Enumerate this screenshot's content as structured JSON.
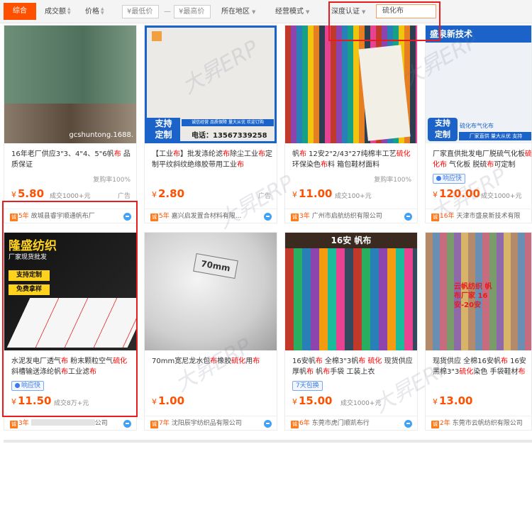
{
  "filter_bar": {
    "sort_default": "综合",
    "sort_volume": "成交额",
    "sort_price": "价格",
    "min_price_placeholder": "¥最低价",
    "max_price_placeholder": "¥最高价",
    "price_separator": "—",
    "region": "所在地区",
    "business_mode": "经营模式",
    "depth_cert": "深度认证",
    "search_value": "硫化布"
  },
  "watermark": "大昇ERP",
  "products": [
    {
      "title_parts": [
        "16年老厂供应3\"3、4\"4、5\"6帆布 品质保证"
      ],
      "repurchase": "复购率100%",
      "price": "5.80",
      "sold": "成交1000+元",
      "ad": "广告",
      "years": "5年",
      "company": "故城县睿宇顺通帆布厂",
      "image_caption": "gcshuntong.1688."
    },
    {
      "title_parts": [
        "【工业布】批发涤纶滤布除尘工业布定制平纹斜纹绝缘胶带用工业布"
      ],
      "price": "2.80",
      "ad": "广告",
      "years": "5年",
      "company": "嘉兴启发置合材料有限...",
      "image_badge_1": "支持",
      "image_badge_2": "定制",
      "image_phone": "电话：13567339258",
      "image_slogan": "诚信经营 品质保障 量大从优 欢迎订购"
    },
    {
      "title_parts": [
        "帆布 12安2\"2/43\"27纯棉丰工艺硫化环保染色布料 箱包鞋材面料"
      ],
      "repurchase": "复购率100%",
      "price": "11.00",
      "sold": "成交100+元",
      "years": "3年",
      "company": "广州市启航纺织有限公司"
    },
    {
      "title_parts": [
        "厂家直供批发电厂脱硫气化板硫化布 气化板 脱硫布可定制"
      ],
      "badge": "响应快",
      "price": "120.00",
      "sold": "成交1000+元",
      "years": "16年",
      "company": "天津市盛泉新技术有限",
      "image_header": "盛泉新技术",
      "image_badge_1": "支持",
      "image_badge_2": "定制",
      "image_slogan": "厂家直供 量大从优 支持",
      "image_label": "硫化布气化布"
    },
    {
      "title_parts": [
        "水泥发电厂透气布 粉末颗粒空气硫化斜槽输送涤纶帆布工业滤布"
      ],
      "badge": "响应快",
      "price": "11.50",
      "sold": "成交8万+元",
      "years": "3年",
      "company": "公司",
      "image_header": "隆盛纺织",
      "image_sub": "厂家现货批发",
      "image_badge_1": "支持定制",
      "image_badge_2": "免费拿样"
    },
    {
      "title_parts": [
        "70mm宽尼龙水包布橡胶硫化用布"
      ],
      "price": "1.00",
      "years": "7年",
      "company": "沈阳辰宇纺织品有限公司",
      "image_label": "70mm"
    },
    {
      "title_parts": [
        "16安帆布 全棉3\"3帆布 硫化 现货供应厚帆布 帆布手袋 工装上衣"
      ],
      "badge_green": "7天包换",
      "price": "15.00",
      "sold": "成交1000+元",
      "years": "6年",
      "company": "东莞市虎门顺凯布行",
      "image_header": "16安 帆布"
    },
    {
      "title_parts": [
        "现货供应 全棉16安帆布 16安黑棉3\"3硫化染色 手袋鞋材布料"
      ],
      "price": "13.00",
      "years": "2年",
      "company": "东莞市云帆纺织有限公司",
      "image_text": "云帆纺织 帆布厂家 16安-20安"
    }
  ],
  "colors": {
    "accent": "#ff5000",
    "highlight": "#e81c1c",
    "keyword": "#ff0000"
  }
}
